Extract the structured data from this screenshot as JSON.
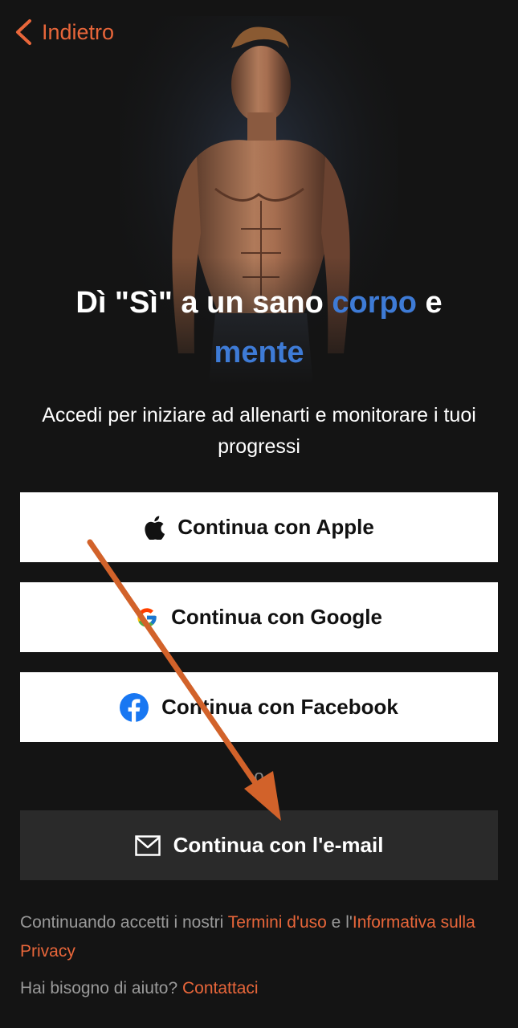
{
  "nav": {
    "back_label": "Indietro"
  },
  "hero": {
    "image": "muscular-man-illustration"
  },
  "headline": {
    "part1": "Dì \"Sì\" a un sano ",
    "accent1": "corpo",
    "part2": " e ",
    "accent2": "mente"
  },
  "subtitle": "Accedi per iniziare ad allenarti e monitorare i tuoi progressi",
  "buttons": {
    "apple": {
      "label": "Continua con Apple",
      "icon": "apple-icon"
    },
    "google": {
      "label": "Continua con Google",
      "icon": "google-icon"
    },
    "facebook": {
      "label": "Continua con Facebook",
      "icon": "facebook-icon"
    },
    "email": {
      "label": "Continua con l'e-mail",
      "icon": "mail-icon"
    }
  },
  "separator": "o",
  "legal": {
    "prefix": "Continuando accetti i nostri ",
    "terms_link": "Termini d'uso",
    "middle": " e l'",
    "privacy_link": "Informativa sulla Privacy"
  },
  "help": {
    "prefix": "Hai bisogno di aiuto? ",
    "contact_link": "Contattaci"
  },
  "colors": {
    "background": "#141414",
    "accent_orange": "#e8663a",
    "accent_blue": "#3e7bd6",
    "button_light": "#ffffff",
    "button_dark": "#2a2a2a",
    "annotation_arrow": "#d2622a"
  }
}
